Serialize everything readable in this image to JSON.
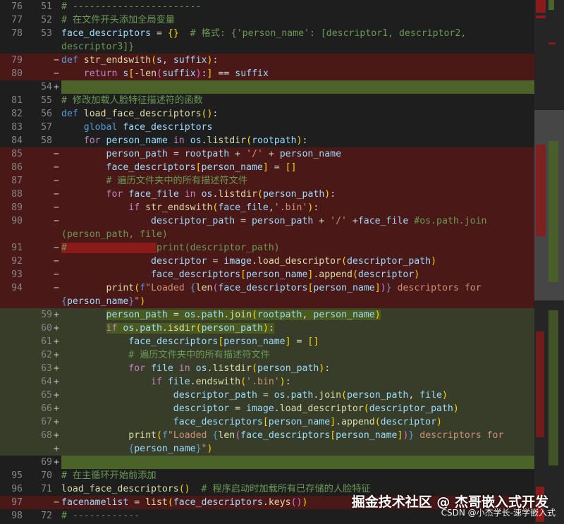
{
  "lines": [
    {
      "old": "76",
      "new": "51",
      "mark": "",
      "kind": "ctx",
      "html": "<span class='com'># -----------------------</span>"
    },
    {
      "old": "77",
      "new": "52",
      "mark": "",
      "kind": "ctx",
      "html": "<span class='com'># 在文件开头添加全局变量</span>"
    },
    {
      "old": "78",
      "new": "53",
      "mark": "",
      "kind": "ctx",
      "html": "<span class='var'>face_descriptors</span> = <span class='lbr'>{}</span>  <span class='com'># 格式: {'person_name': [descriptor1, descriptor2,</span>"
    },
    {
      "old": "",
      "new": "",
      "mark": "",
      "kind": "ctx",
      "html": "<span class='com'>descriptor3]}</span>"
    },
    {
      "old": "79",
      "new": "",
      "mark": "−",
      "kind": "del",
      "html": "<span class='kw'>def</span> <span class='fn'>str_endswith</span><span class='lbr'>(</span><span class='var'>s</span>, <span class='var'>suffix</span><span class='lbr'>)</span>:"
    },
    {
      "old": "80",
      "new": "",
      "mark": "−",
      "kind": "del",
      "html": "    <span class='ctl'>return</span> <span class='var'>s</span><span class='lbr'>[</span>-<span class='fn'>len</span><span class='lbr2'>(</span><span class='var'>suffix</span><span class='lbr2'>)</span>:<span class='lbr'>]</span> == <span class='var'>suffix</span>"
    },
    {
      "old": "",
      "new": "54",
      "mark": "+",
      "kind": "addfull",
      "html": ""
    },
    {
      "old": "81",
      "new": "55",
      "mark": "",
      "kind": "ctx",
      "html": "<span class='com'># 修改加载人脸特征描述符的函数</span>"
    },
    {
      "old": "82",
      "new": "56",
      "mark": "",
      "kind": "ctx",
      "html": "<span class='kw'>def</span> <span class='fn'>load_face_descriptors</span><span class='lbr'>()</span>:"
    },
    {
      "old": "83",
      "new": "57",
      "mark": "",
      "kind": "ctx",
      "html": "    <span class='kw'>global</span> <span class='var'>face_descriptors</span>"
    },
    {
      "old": "84",
      "new": "58",
      "mark": "",
      "kind": "ctx",
      "html": "    <span class='ctl'>for</span> <span class='var'>person_name</span> <span class='ctl'>in</span> <span class='var'>os</span>.<span class='fn'>listdir</span><span class='lbr'>(</span><span class='var'>rootpath</span><span class='lbr'>)</span>:"
    },
    {
      "old": "85",
      "new": "",
      "mark": "−",
      "kind": "del",
      "html": "        <span class='var'>person_path</span> = <span class='var'>rootpath</span> + <span class='str'>'/'</span> + <span class='var'>person_name</span>"
    },
    {
      "old": "86",
      "new": "",
      "mark": "−",
      "kind": "del",
      "html": "        <span class='var'>face_descriptors</span><span class='lbr'>[</span><span class='var'>person_name</span><span class='lbr'>]</span> = <span class='lbr'>[]</span>"
    },
    {
      "old": "87",
      "new": "",
      "mark": "−",
      "kind": "del",
      "html": "        <span class='com'># 遍历文件夹中的所有描述符文件</span>"
    },
    {
      "old": "88",
      "new": "",
      "mark": "−",
      "kind": "del",
      "html": "        <span class='ctl'>for</span> <span class='var'>face_file</span> <span class='ctl'>in</span> <span class='var'>os</span>.<span class='fn'>listdir</span><span class='lbr'>(</span><span class='var'>person_path</span><span class='lbr'>)</span>:"
    },
    {
      "old": "89",
      "new": "",
      "mark": "−",
      "kind": "del",
      "html": "            <span class='ctl'>if</span> <span class='fn'>str_endswith</span><span class='lbr'>(</span><span class='var'>face_file</span>,<span class='str'>'.bin'</span><span class='lbr'>)</span>:"
    },
    {
      "old": "90",
      "new": "",
      "mark": "−",
      "kind": "del",
      "html": "                <span class='var'>descriptor_path</span> = <span class='var'>person_path</span> + <span class='str'>'/'</span> +<span class='var'>face_file</span> <span class='com'>#os.path.join</span>"
    },
    {
      "old": "",
      "new": "",
      "mark": "",
      "kind": "del",
      "html": "<span class='com'>(person_path, file)</span>"
    },
    {
      "old": "91",
      "new": "",
      "mark": "−",
      "kind": "del",
      "html": "<span class='hl-del'><span class='com'>#                </span></span><span class='com'>print(descriptor_path)</span>"
    },
    {
      "old": "92",
      "new": "",
      "mark": "−",
      "kind": "del",
      "html": "                <span class='var'>descriptor</span> = <span class='var'>image</span>.<span class='fn'>load_descriptor</span><span class='lbr'>(</span><span class='var'>descriptor_path</span><span class='lbr'>)</span>"
    },
    {
      "old": "93",
      "new": "",
      "mark": "−",
      "kind": "del",
      "html": "                <span class='var'>face_descriptors</span><span class='lbr'>[</span><span class='var'>person_name</span><span class='lbr'>]</span>.<span class='fn'>append</span><span class='lbr'>(</span><span class='var'>descriptor</span><span class='lbr'>)</span>"
    },
    {
      "old": "94",
      "new": "",
      "mark": "−",
      "kind": "del",
      "html": "        <span class='fn'>print</span><span class='lbr'>(</span><span class='kw'>f</span><span class='str'>\"Loaded </span><span class='kw'>{</span><span class='fn'>len</span><span class='lbr2'>(</span><span class='var'>face_descriptors</span><span class='lbr'>[</span><span class='var'>person_name</span><span class='lbr'>]</span><span class='lbr2'>)</span><span class='kw'>}</span><span class='str'> descriptors for</span>"
    },
    {
      "old": "",
      "new": "",
      "mark": "",
      "kind": "del",
      "html": "<span class='kw'>{</span><span class='var'>person_name</span><span class='kw'>}</span><span class='str'>\"</span><span class='lbr'>)</span>"
    },
    {
      "old": "",
      "new": "59",
      "mark": "+",
      "kind": "add",
      "html": "        <span class='hl-add'><span class='var'>person_path</span> = <span class='var'>os</span>.<span class='var'>path</span>.<span class='fn'>join</span><span class='lbr'>(</span><span class='var'>rootpath</span>, <span class='var'>person_name</span><span class='lbr'>)</span></span>"
    },
    {
      "old": "",
      "new": "60",
      "mark": "+",
      "kind": "add",
      "html": "        <span class='hl-add'><span class='ctl'>if</span> <span class='var'>os</span>.<span class='var'>path</span>.<span class='fn'>isdir</span><span class='lbr'>(</span><span class='var'>person_path</span><span class='lbr'>)</span>:</span>"
    },
    {
      "old": "",
      "new": "61",
      "mark": "+",
      "kind": "add",
      "html": "            <span class='var'>face_descriptors</span><span class='lbr'>[</span><span class='var'>person_name</span><span class='lbr'>]</span> = <span class='lbr'>[]</span>"
    },
    {
      "old": "",
      "new": "62",
      "mark": "+",
      "kind": "add",
      "html": "            <span class='com'># 遍历文件夹中的所有描述符文件</span>"
    },
    {
      "old": "",
      "new": "63",
      "mark": "+",
      "kind": "add",
      "html": "            <span class='ctl'>for</span> <span class='var'>file</span> <span class='ctl'>in</span> <span class='var'>os</span>.<span class='fn'>listdir</span><span class='lbr'>(</span><span class='var'>person_path</span><span class='lbr'>)</span>:"
    },
    {
      "old": "",
      "new": "64",
      "mark": "+",
      "kind": "add",
      "html": "                <span class='ctl'>if</span> <span class='var'>file</span>.<span class='fn'>endswith</span><span class='lbr'>(</span><span class='str'>'.bin'</span><span class='lbr'>)</span>:"
    },
    {
      "old": "",
      "new": "65",
      "mark": "+",
      "kind": "add",
      "html": "                    <span class='var'>descriptor_path</span> = <span class='var'>os</span>.<span class='var'>path</span>.<span class='fn'>join</span><span class='lbr'>(</span><span class='var'>person_path</span>, <span class='var'>file</span><span class='lbr'>)</span>"
    },
    {
      "old": "",
      "new": "66",
      "mark": "+",
      "kind": "add",
      "html": "                    <span class='var'>descriptor</span> = <span class='var'>image</span>.<span class='fn'>load_descriptor</span><span class='lbr'>(</span><span class='var'>descriptor_path</span><span class='lbr'>)</span>"
    },
    {
      "old": "",
      "new": "67",
      "mark": "+",
      "kind": "add",
      "html": "                    <span class='var'>face_descriptors</span><span class='lbr'>[</span><span class='var'>person_name</span><span class='lbr'>]</span>.<span class='fn'>append</span><span class='lbr'>(</span><span class='var'>descriptor</span><span class='lbr'>)</span>"
    },
    {
      "old": "",
      "new": "68",
      "mark": "+",
      "kind": "add",
      "html": "            <span class='fn'>print</span><span class='lbr'>(</span><span class='kw'>f</span><span class='str'>\"Loaded </span><span class='kw'>{</span><span class='fn'>len</span><span class='lbr2'>(</span><span class='var'>face_descriptors</span><span class='lbr'>[</span><span class='var'>person_name</span><span class='lbr'>]</span><span class='lbr2'>)</span><span class='kw'>}</span><span class='str'> descriptors for</span>"
    },
    {
      "old": "",
      "new": "",
      "mark": "+",
      "kind": "add",
      "html": "            <span class='kw'>{</span><span class='var'>person_name</span><span class='kw'>}</span><span class='str'>\"</span><span class='lbr'>)</span>"
    },
    {
      "old": "",
      "new": "69",
      "mark": "+",
      "kind": "addfull",
      "html": ""
    },
    {
      "old": "95",
      "new": "70",
      "mark": "",
      "kind": "ctx",
      "html": "<span class='com'># 在主循环开始前添加</span>"
    },
    {
      "old": "96",
      "new": "71",
      "mark": "",
      "kind": "ctx",
      "html": "<span class='fn'>load_face_descriptors</span><span class='lbr'>()</span>  <span class='com'># 程序启动时加载所有已存储的人脸特征</span>"
    },
    {
      "old": "97",
      "new": "",
      "mark": "−",
      "kind": "del",
      "html": "<span class='var'>facenamelist</span> = <span class='fn'>list</span><span class='lbr'>(</span><span class='var'>face_descriptors</span>.<span class='fn'>keys</span><span class='lbr2'>()</span><span class='lbr'>)</span>"
    },
    {
      "old": "98",
      "new": "72",
      "mark": "",
      "kind": "ctx",
      "html": "<span class='com'># ------------</span>"
    }
  ],
  "watermark": {
    "main": "掘金技术社区 @ 杰哥嵌入式开发",
    "sub": "CSDN @小杰学长-速学嵌入式"
  },
  "colors": {
    "deleted_bg": "#4b1818",
    "added_bg": "#373d29",
    "added_full_bg": "#4b6328"
  }
}
